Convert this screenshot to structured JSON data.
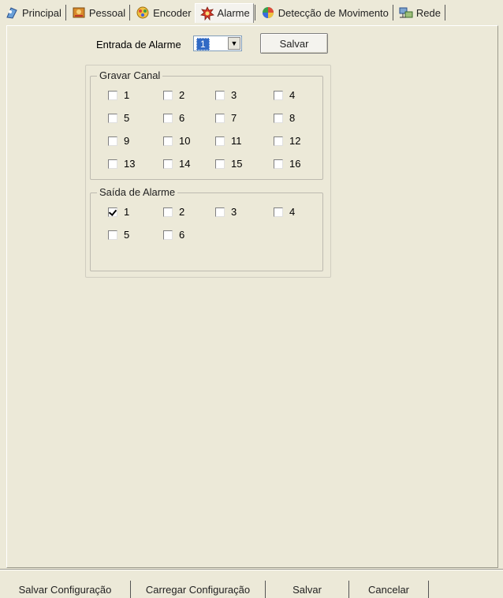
{
  "tabs": [
    {
      "label": "Principal",
      "icon": "principal-icon",
      "active": false
    },
    {
      "label": "Pessoal",
      "icon": "pessoal-icon",
      "active": false
    },
    {
      "label": "Encoder",
      "icon": "encoder-icon",
      "active": false
    },
    {
      "label": "Alarme",
      "icon": "alarme-icon",
      "active": true
    },
    {
      "label": "Detecção de Movimento",
      "icon": "deteccao-icon",
      "active": false
    },
    {
      "label": "Rede",
      "icon": "rede-icon",
      "active": false
    }
  ],
  "alarm_input": {
    "label": "Entrada de Alarme",
    "value": "1"
  },
  "save_top_label": "Salvar",
  "record_channel": {
    "title": "Gravar Canal",
    "channels": [
      {
        "label": "1",
        "checked": false
      },
      {
        "label": "2",
        "checked": false
      },
      {
        "label": "3",
        "checked": false
      },
      {
        "label": "4",
        "checked": false
      },
      {
        "label": "5",
        "checked": false
      },
      {
        "label": "6",
        "checked": false
      },
      {
        "label": "7",
        "checked": false
      },
      {
        "label": "8",
        "checked": false
      },
      {
        "label": "9",
        "checked": false
      },
      {
        "label": "10",
        "checked": false
      },
      {
        "label": "11",
        "checked": false
      },
      {
        "label": "12",
        "checked": false
      },
      {
        "label": "13",
        "checked": false
      },
      {
        "label": "14",
        "checked": false
      },
      {
        "label": "15",
        "checked": false
      },
      {
        "label": "16",
        "checked": false
      }
    ]
  },
  "alarm_output": {
    "title": "Saída de Alarme",
    "outputs": [
      {
        "label": "1",
        "checked": true
      },
      {
        "label": "2",
        "checked": false
      },
      {
        "label": "3",
        "checked": false
      },
      {
        "label": "4",
        "checked": false
      },
      {
        "label": "5",
        "checked": false
      },
      {
        "label": "6",
        "checked": false
      }
    ]
  },
  "footer": {
    "save_config": "Salvar Configuração",
    "load_config": "Carregar Configuração",
    "save": "Salvar",
    "cancel": "Cancelar"
  }
}
